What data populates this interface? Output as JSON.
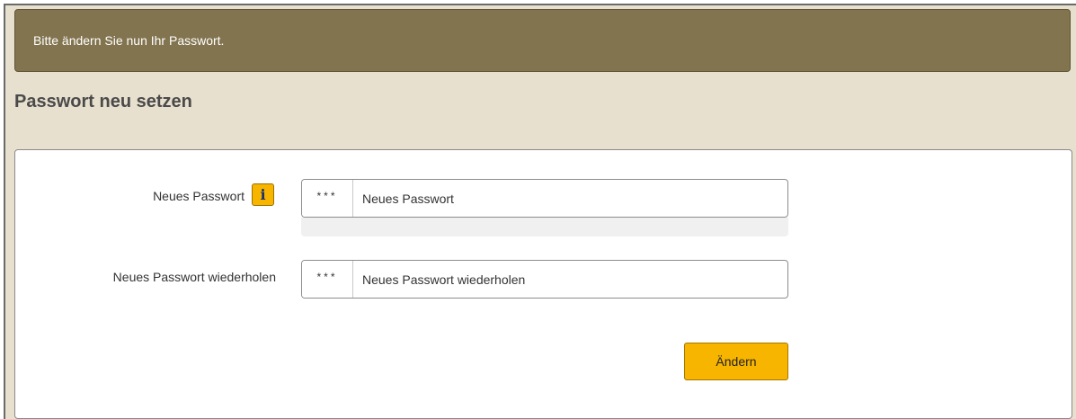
{
  "notice": {
    "text": "Bitte ändern Sie nun Ihr Passwort."
  },
  "page": {
    "title": "Passwort neu setzen"
  },
  "form": {
    "new_password": {
      "label": "Neues Passwort",
      "addon": "***",
      "placeholder": "Neues Passwort",
      "value": "",
      "info_icon": "info-icon"
    },
    "repeat_password": {
      "label": "Neues Passwort wiederholen",
      "addon": "***",
      "placeholder": "Neues Passwort wiederholen",
      "value": ""
    },
    "submit_label": "Ändern"
  },
  "colors": {
    "notice_bg": "#82744f",
    "page_bg": "#e8e0ce",
    "accent": "#f7b500"
  }
}
